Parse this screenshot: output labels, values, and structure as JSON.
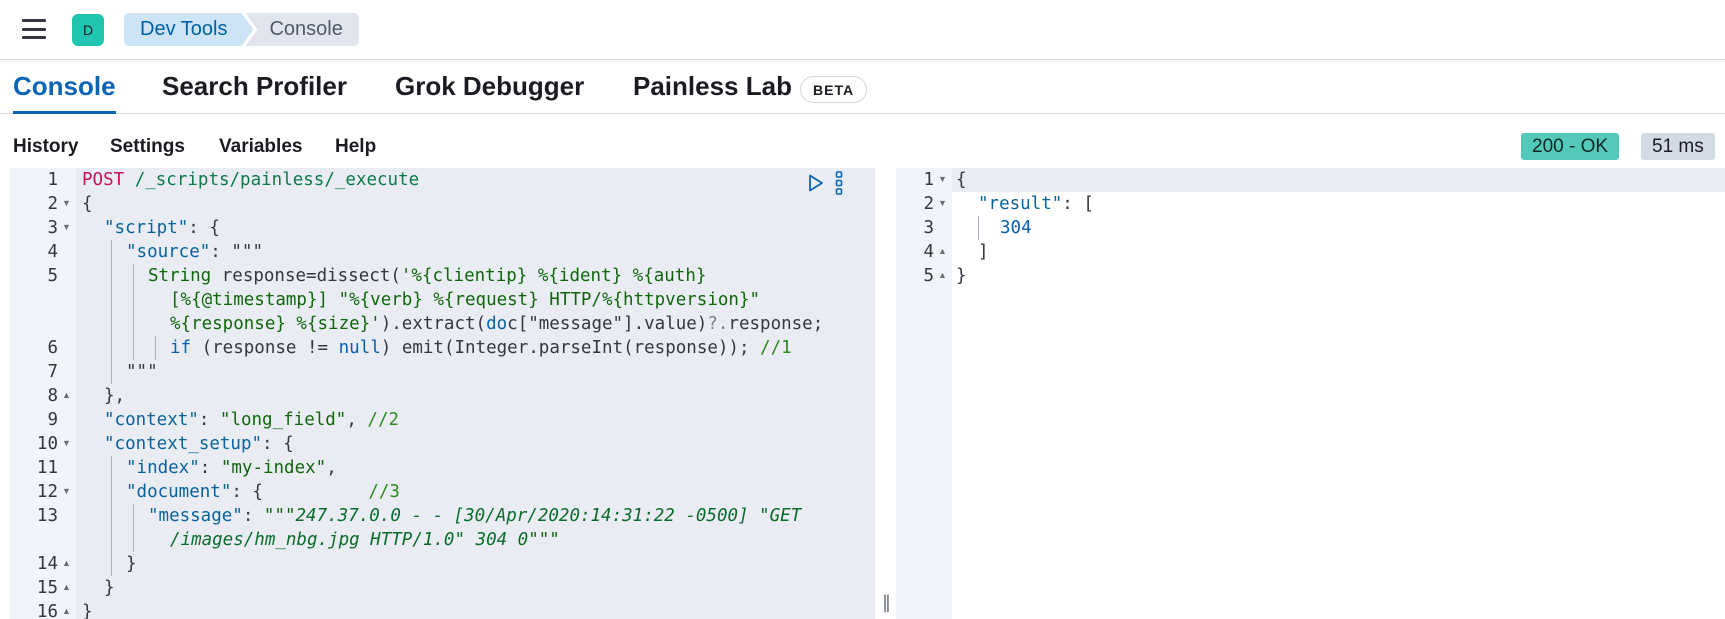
{
  "header": {
    "avatar_letter": "D",
    "breadcrumbs": [
      "Dev Tools",
      "Console"
    ]
  },
  "tabs": [
    {
      "label": "Console",
      "active": true
    },
    {
      "label": "Search Profiler",
      "active": false
    },
    {
      "label": "Grok Debugger",
      "active": false
    },
    {
      "label": "Painless Lab",
      "active": false
    }
  ],
  "beta_badge": "BETA",
  "toolbar": {
    "items": [
      "History",
      "Settings",
      "Variables",
      "Help"
    ],
    "status": "200 - OK",
    "time": "51 ms",
    "status_color": "#54c8b9"
  },
  "editor": {
    "line_numbers": [
      "1",
      "2",
      "3",
      "4",
      "5",
      "6",
      "7",
      "8",
      "9",
      "10",
      "11",
      "12",
      "13",
      "14",
      "15",
      "16"
    ],
    "lines": {
      "l1_method": "POST",
      "l1_url": " /_scripts/painless/_execute",
      "l2": "{",
      "l3_key": "\"script\"",
      "l3_rest": ": {",
      "l4_key": "\"source\"",
      "l4_rest": ": \"\"\"",
      "l5_a": "String",
      "l5_b": " response=dissect(",
      "l5_c": "'%{clientip} %{ident} %{auth}",
      "l5w1": "[%{@timestamp}] \"%{verb} %{request} HTTP/%{httpversion}\"",
      "l5w2_a": "%{response} %{size}'",
      "l5w2_b": ").extract(",
      "l5w2_c": "do",
      "l5w2_d": "c[\"message\"].value)",
      "l5w2_e": "?.",
      "l5w2_f": "response;",
      "l6_a": "if",
      "l6_b": " (response != ",
      "l6_c": "null",
      "l6_d": ") emit(Integer.parseInt(response)); ",
      "l6_e": "//1",
      "l7": "\"\"\"",
      "l8": "},",
      "l9_key": "\"context\"",
      "l9_mid": ": ",
      "l9_val": "\"long_field\"",
      "l9_sep": ", ",
      "l9_cm": "//2",
      "l10_key": "\"context_setup\"",
      "l10_rest": ": {",
      "l11_key": "\"index\"",
      "l11_mid": ": ",
      "l11_val": "\"my-index\"",
      "l11_end": ",",
      "l12_key": "\"document\"",
      "l12_rest": ": {          ",
      "l12_cm": "//3",
      "l13_key": "\"message\"",
      "l13_mid": ": ",
      "l13_q": "\"\"\"",
      "l13_val": "247.37.0.0 - - [30/Apr/2020:14:31:22 -0500] \"GET",
      "l13w_val": "/images/hm_nbg.jpg HTTP/1.0\" 304 0",
      "l13w_q": "\"\"\"",
      "l14": "}",
      "l15": "}",
      "l16": "}"
    }
  },
  "output": {
    "line_numbers": [
      "1",
      "2",
      "3",
      "4",
      "5"
    ],
    "l1": "{",
    "l2_key": "\"result\"",
    "l2_rest": ": [",
    "l3_val": "304",
    "l4": "]",
    "l5": "}"
  }
}
